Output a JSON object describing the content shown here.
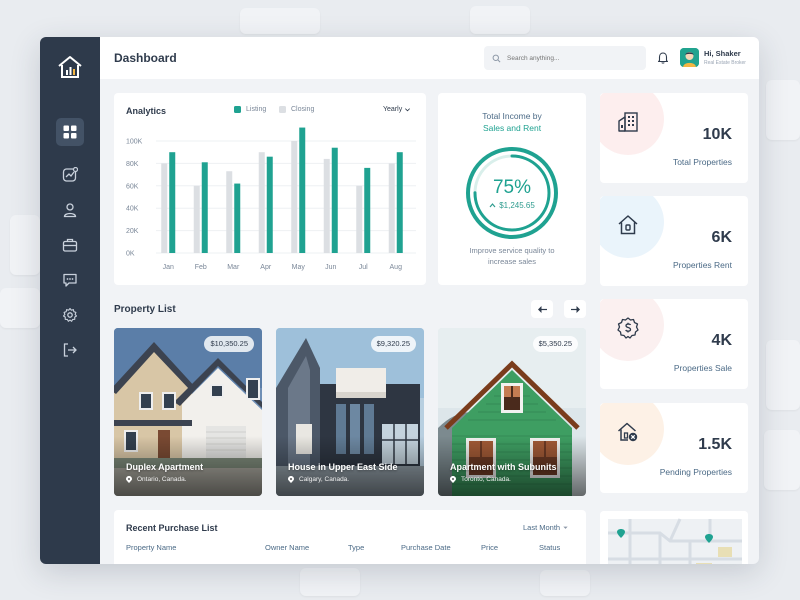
{
  "header": {
    "title": "Dashboard",
    "search_placeholder": "Search anything...",
    "user_name": "Hi, Shaker",
    "user_role": "Real Estate Broker"
  },
  "sidebar": {
    "items": [
      {
        "name": "dashboard",
        "icon": "grid-icon",
        "active": true
      },
      {
        "name": "analytics",
        "icon": "trend-chart-icon"
      },
      {
        "name": "profile",
        "icon": "user-icon"
      },
      {
        "name": "portfolio",
        "icon": "briefcase-icon"
      },
      {
        "name": "messages",
        "icon": "chat-icon"
      },
      {
        "name": "settings",
        "icon": "gear-icon"
      },
      {
        "name": "logout",
        "icon": "logout-icon"
      }
    ]
  },
  "analytics": {
    "title": "Analytics",
    "legend_listing": "Listing",
    "legend_closing": "Closing",
    "period": "Yearly"
  },
  "chart_data": {
    "type": "bar",
    "categories": [
      "Jan",
      "Feb",
      "Mar",
      "Apr",
      "May",
      "Jun",
      "Jul",
      "Aug"
    ],
    "series": [
      {
        "name": "Closing",
        "color": "#dcdfe3",
        "values": [
          80,
          60,
          73,
          90,
          100,
          84,
          60,
          80
        ]
      },
      {
        "name": "Listing",
        "color": "#1fa291",
        "values": [
          90,
          81,
          62,
          86,
          112,
          94,
          76,
          90
        ]
      }
    ],
    "yticks": [
      "100K",
      "80K",
      "60K",
      "40K",
      "20K",
      "0K"
    ],
    "ylim": [
      0,
      120
    ],
    "grid": true,
    "legend": "top"
  },
  "income": {
    "title_line1": "Total Income by",
    "title_line2": "Sales and Rent",
    "percent": "75%",
    "percent_value": 0.75,
    "amount": "$1,245.65",
    "note": "Improve service quality to increase sales"
  },
  "stats": [
    {
      "value": "10K",
      "label": "Total Properties",
      "icon": "buildings-icon",
      "tint": "#fdeeee"
    },
    {
      "value": "6K",
      "label": "Properties Rent",
      "icon": "house-rent-icon",
      "tint": "#eaf4fb"
    },
    {
      "value": "4K",
      "label": "Properties Sale",
      "icon": "dollar-badge-icon",
      "tint": "#fbf0f0"
    },
    {
      "value": "1.5K",
      "label": "Pending Properties",
      "icon": "house-pending-icon",
      "tint": "#fdf1e6"
    }
  ],
  "property_list": {
    "title": "Property List",
    "items": [
      {
        "price": "$10,350.25",
        "name": "Duplex Apartment",
        "location": "Ontario, Canada."
      },
      {
        "price": "$9,320.25",
        "name": "House in Upper East Side",
        "location": "Calgary, Canada."
      },
      {
        "price": "$5,350.25",
        "name": "Apartment with Subunits",
        "location": "Toronto, Canada."
      }
    ]
  },
  "recent": {
    "title": "Recent Purchase List",
    "period": "Last Month",
    "columns": [
      "Property Name",
      "Owner Name",
      "Type",
      "Purchase Date",
      "Price",
      "Status"
    ]
  },
  "colors": {
    "accent": "#1fa291",
    "sidebar": "#2e3a4b",
    "background": "#f1f3f6"
  }
}
